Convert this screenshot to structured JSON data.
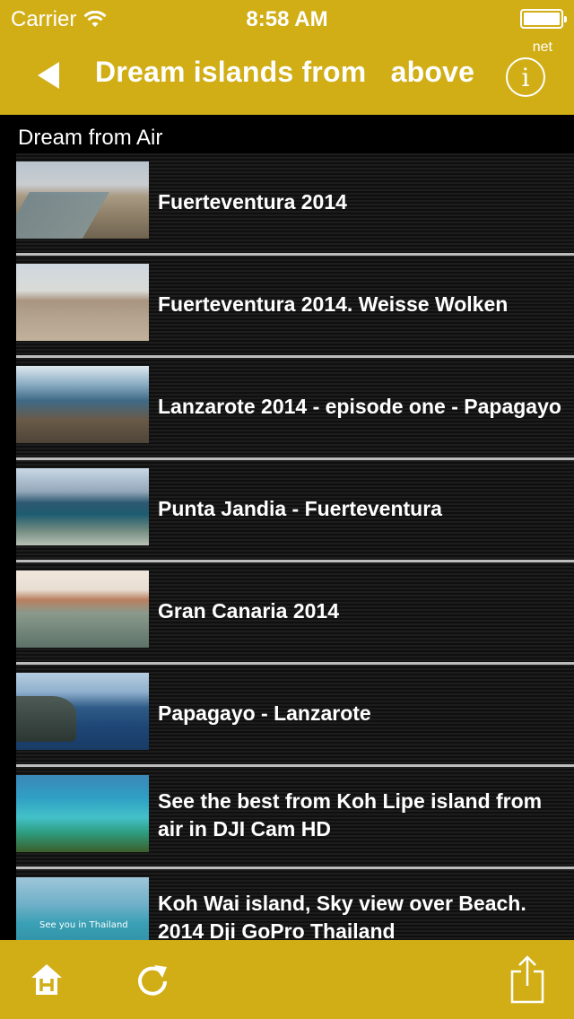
{
  "status_bar": {
    "carrier": "Carrier",
    "time": "8:58 AM"
  },
  "nav": {
    "title": "Dream islands from   above",
    "net_label": "net",
    "info_glyph": "i",
    "icons": [
      "back-arrow-icon",
      "info-icon"
    ]
  },
  "section": {
    "header": "Dream from Air"
  },
  "videos": [
    {
      "title": "Fuerteventura 2014"
    },
    {
      "title": "Fuerteventura 2014. Weisse Wolken"
    },
    {
      "title": "Lanzarote 2014 - episode one - Papagayo"
    },
    {
      "title": "Punta Jandia - Fuerteventura"
    },
    {
      "title": "Gran Canaria 2014"
    },
    {
      "title": "Papagayo - Lanzarote"
    },
    {
      "title": "See the best from Koh Lipe island from air in DJI Cam HD"
    },
    {
      "title": "Koh Wai island, Sky view over Beach. 2014 Dji GoPro Thailand",
      "thumb_caption": "See you in Thailand"
    }
  ],
  "toolbar": {
    "icons": [
      "home-icon",
      "refresh-icon",
      "share-icon"
    ],
    "home_glyph": "H"
  },
  "colors": {
    "accent": "#d1ae16",
    "background": "#000000",
    "text": "#ffffff",
    "separator": "#bdbdbd"
  }
}
